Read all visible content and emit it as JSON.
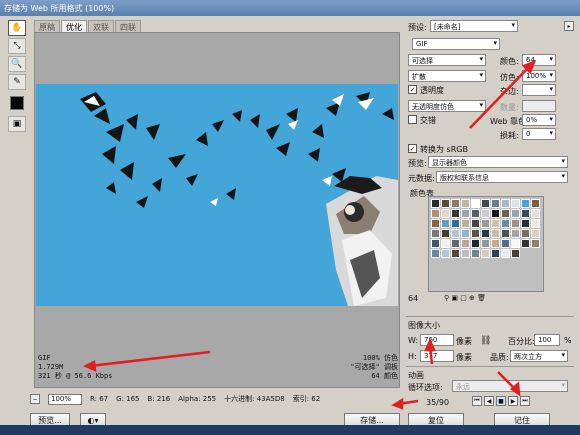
{
  "window": {
    "title": "存储为 Web 所用格式 (100%)"
  },
  "tabs": [
    "原稿",
    "优化",
    "双联",
    "四联"
  ],
  "image_info": {
    "left": [
      "GIF",
      "1.729M",
      "321 秒 @ 56.6 Kbps"
    ],
    "right": [
      "100% 仿色",
      "\"可选择\" 调板",
      "64 颜色"
    ]
  },
  "status": {
    "zoom": "100%",
    "r": "R: 67",
    "g": "G: 165",
    "b": "B: 216",
    "alpha": "Alpha: 255",
    "hex": "十六进制: 43A5D8",
    "index": "索引: 62",
    "frame": "35/90"
  },
  "buttons": {
    "preview": "预览...",
    "save": "存储...",
    "reset": "复位",
    "remember": "记住"
  },
  "panel": {
    "preset_label": "预设:",
    "preset_value": "[未命名]",
    "format": "GIF",
    "reduction": "可选择",
    "dither_algo": "扩散",
    "transparency_label": "透明度",
    "matte_dither": "无透明度仿色",
    "interlace_label": "交错",
    "colors_label": "颜色:",
    "colors_value": "64",
    "dither_label": "仿色:",
    "dither_value": "100%",
    "matte_label": "杂边:",
    "amount_label": "数量:",
    "web_snap_label": "Web 靠色:",
    "web_snap_value": "0%",
    "lossy_label": "损耗:",
    "lossy_value": "0",
    "convert_srgb": "转换为 sRGB",
    "preview_label": "预览:",
    "preview_value": "显示器颜色",
    "metadata_label": "元数据:",
    "metadata_value": "版权和联系信息",
    "color_table_title": "颜色表",
    "color_count": "64",
    "image_size_title": "图像大小",
    "w_label": "W:",
    "w_value": "760",
    "h_label": "H:",
    "h_value": "377",
    "px_unit": "像素",
    "percent_label": "百分比:",
    "percent_value": "100",
    "percent_unit": "%",
    "quality_label": "品质:",
    "quality_value": "两次立方",
    "animation_title": "动画",
    "loop_label": "循环选项:",
    "loop_value": "永远"
  },
  "colors": {
    "artwork_bg": "#43A5D8",
    "annotation_arrow": "#E02020",
    "swatches": [
      "#2b2b2b",
      "#5a4a3a",
      "#8b7b6b",
      "#c4b4a4",
      "#ffffff",
      "#404850",
      "#6b7c8a",
      "#a8b8c4",
      "#d8e4ec",
      "#43a5d8",
      "#7a5c40",
      "#b49070",
      "#e8d4c0",
      "#303840",
      "#9ca4ac",
      "#58606a",
      "#cccccc",
      "#1a1a1a",
      "#706050",
      "#94a4b0",
      "#3a4a58",
      "#e0e0e0",
      "#886644",
      "#5f9fc7",
      "#2f6f9a",
      "#bbb0a0",
      "#444444",
      "#999999",
      "#d0c0b0",
      "#6a8aa8",
      "#a09080",
      "#20303c",
      "#ece8e0",
      "#787878",
      "#4a3a2a",
      "#b0c4d4",
      "#8fb4d0",
      "#605040",
      "#2a3a48",
      "#c8bca8",
      "#505050",
      "#a4a4a4",
      "#7d6d5d",
      "#dcd0c0",
      "#3c5870",
      "#f4f0ec",
      "#666666",
      "#b8a898",
      "#1e2830",
      "#8a98a4",
      "#caa888",
      "#4e6e8c",
      "#f8f8f8",
      "#343434",
      "#90806e",
      "#6888a4",
      "#a8c8e0",
      "#584838",
      "#bcbcbc",
      "#72828e",
      "#d8cab8",
      "#2c4458",
      "#e8ecf0",
      "#484038"
    ]
  }
}
